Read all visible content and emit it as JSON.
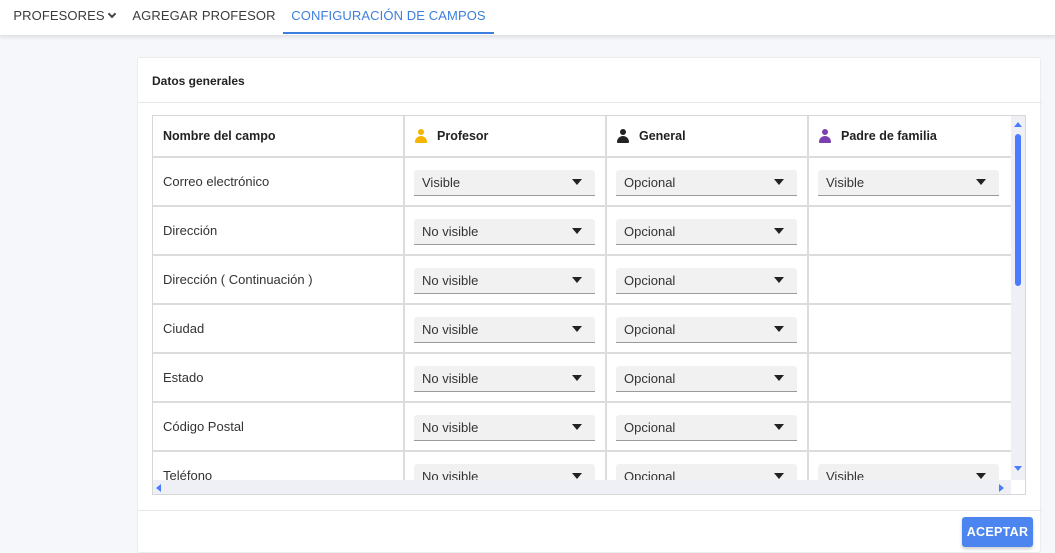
{
  "nav": {
    "tabs": [
      {
        "label": "PROFESORES"
      },
      {
        "label": "AGREGAR PROFESOR"
      },
      {
        "label": "CONFIGURACIÓN DE CAMPOS"
      }
    ]
  },
  "card": {
    "title": "Datos generales",
    "accept_label": "ACEPTAR"
  },
  "table": {
    "headers": {
      "field": "Nombre del campo",
      "teacher": "Profesor",
      "general": "General",
      "parent": "Padre de familia"
    },
    "rows": [
      {
        "field": "Correo electrónico",
        "teacher": "Visible",
        "general": "Opcional",
        "parent": "Visible"
      },
      {
        "field": "Dirección",
        "teacher": "No visible",
        "general": "Opcional",
        "parent": ""
      },
      {
        "field": "Dirección ( Continuación )",
        "teacher": "No visible",
        "general": "Opcional",
        "parent": ""
      },
      {
        "field": "Ciudad",
        "teacher": "No visible",
        "general": "Opcional",
        "parent": ""
      },
      {
        "field": "Estado",
        "teacher": "No visible",
        "general": "Opcional",
        "parent": ""
      },
      {
        "field": "Código Postal",
        "teacher": "No visible",
        "general": "Opcional",
        "parent": ""
      },
      {
        "field": "Teléfono",
        "teacher": "No visible",
        "general": "Opcional",
        "parent": "Visible"
      }
    ]
  },
  "colors": {
    "accent": "#3d7fdc",
    "button": "#4c85ef",
    "teacher_icon": "#f5b400",
    "general_icon": "#222222",
    "parent_icon": "#7b3fb0",
    "scrollbar": "#4c7bff"
  }
}
